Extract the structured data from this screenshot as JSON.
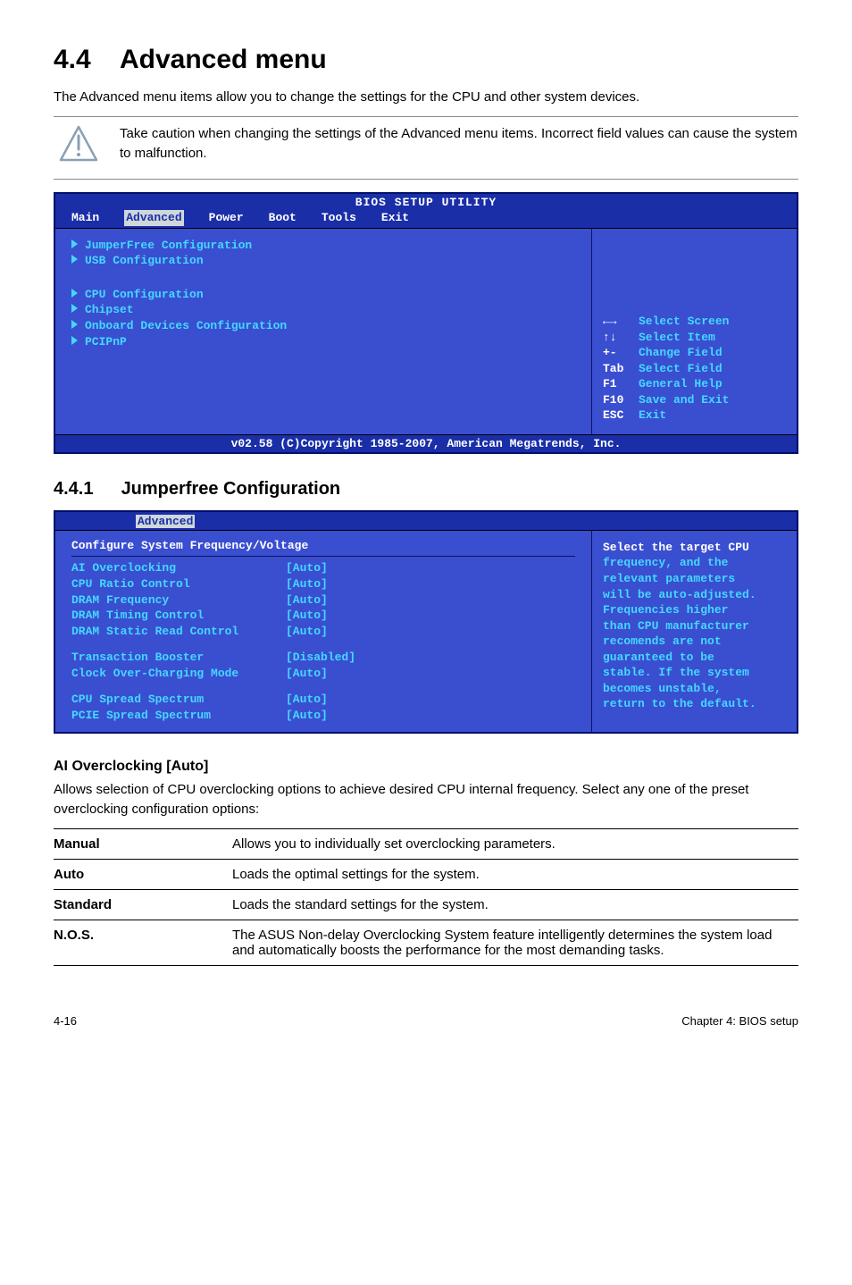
{
  "page": {
    "heading_num": "4.4",
    "heading_text": "Advanced menu",
    "intro": "The Advanced menu items allow you to change the settings for the CPU and other system devices.",
    "caution": "Take caution when changing the settings of the Advanced menu items. Incorrect field values can cause the system to malfunction.",
    "footer_left": "4-16",
    "footer_right": "Chapter 4: BIOS setup"
  },
  "bios1": {
    "title": "BIOS SETUP UTILITY",
    "tabs": [
      "Main",
      "Advanced",
      "Power",
      "Boot",
      "Tools",
      "Exit"
    ],
    "active_tab": "Advanced",
    "menu_items_group1": [
      "JumperFree Configuration",
      "USB Configuration"
    ],
    "menu_items_group2": [
      "CPU Configuration",
      "Chipset",
      "Onboard Devices Configuration",
      "PCIPnP"
    ],
    "help_keys": [
      {
        "key": "←→",
        "label": "Select Screen"
      },
      {
        "key": "↑↓",
        "label": "Select Item"
      },
      {
        "key": "+-",
        "label": "Change Field"
      },
      {
        "key": "Tab",
        "label": "Select Field"
      },
      {
        "key": "F1",
        "label": "General Help"
      },
      {
        "key": "F10",
        "label": "Save and Exit"
      },
      {
        "key": "ESC",
        "label": "Exit"
      }
    ],
    "footer": "v02.58 (C)Copyright 1985-2007, American Megatrends, Inc."
  },
  "section441": {
    "num": "4.4.1",
    "title": "Jumperfree Configuration"
  },
  "bios2": {
    "tab": "Advanced",
    "header": "Configure System Frequency/Voltage",
    "fields_group1": [
      {
        "label": "AI Overclocking",
        "value": "[Auto]"
      },
      {
        "label": "CPU Ratio Control",
        "value": "[Auto]"
      },
      {
        "label": "DRAM Frequency",
        "value": "[Auto]"
      },
      {
        "label": "DRAM Timing Control",
        "value": "[Auto]"
      },
      {
        "label": "DRAM Static Read Control",
        "value": "[Auto]"
      }
    ],
    "fields_group2": [
      {
        "label": "Transaction Booster",
        "value": "[Disabled]"
      },
      {
        "label": "Clock Over-Charging Mode",
        "value": "[Auto]"
      }
    ],
    "fields_group3": [
      {
        "label": "CPU Spread Spectrum",
        "value": "[Auto]"
      },
      {
        "label": "PCIE Spread Spectrum",
        "value": "[Auto]"
      }
    ],
    "help_text_lines": [
      "Select the target CPU",
      "frequency, and the",
      "relevant parameters",
      "will be auto-adjusted.",
      "Frequencies higher",
      "than CPU manufacturer",
      "recomends are not",
      "guaranteed to be",
      "stable. If the system",
      "becomes unstable,",
      "return to the default."
    ]
  },
  "ai_overclocking": {
    "heading": "AI Overclocking [Auto]",
    "desc": "Allows selection of CPU overclocking options to achieve desired CPU internal frequency. Select any one of the preset overclocking configuration options:",
    "rows": [
      {
        "key": "Manual",
        "text": "Allows you to individually set overclocking parameters."
      },
      {
        "key": "Auto",
        "text": "Loads the optimal settings for the system."
      },
      {
        "key": "Standard",
        "text": "Loads the standard settings for the system."
      },
      {
        "key": "N.O.S.",
        "text": "The ASUS Non-delay Overclocking System feature intelligently determines the system load and automatically boosts the performance for the most demanding tasks."
      }
    ]
  }
}
